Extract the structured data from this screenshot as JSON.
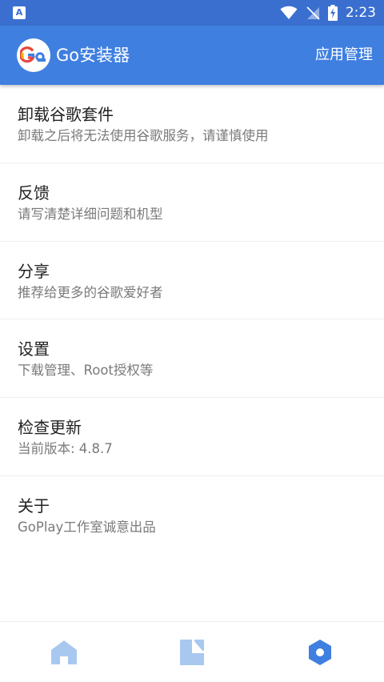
{
  "status_bar": {
    "notification_badge": "A",
    "time": "2:23",
    "icons": [
      "wifi-icon",
      "no-signal-icon",
      "battery-charging-icon"
    ]
  },
  "app_bar": {
    "logo_icon": "go-logo-icon",
    "title": "Go安装器",
    "action_label": "应用管理",
    "background_color": "#3f7fe0"
  },
  "menu": {
    "items": [
      {
        "title": "卸载谷歌套件",
        "subtitle": "卸载之后将无法使用谷歌服务，请谨慎使用"
      },
      {
        "title": "反馈",
        "subtitle": "请写清楚详细问题和机型"
      },
      {
        "title": "分享",
        "subtitle": "推荐给更多的谷歌爱好者"
      },
      {
        "title": "设置",
        "subtitle": "下载管理、Root授权等"
      },
      {
        "title": "检查更新",
        "subtitle": "当前版本: 4.8.7"
      },
      {
        "title": "关于",
        "subtitle": "GoPlay工作室诚意出品"
      }
    ]
  },
  "bottom_nav": {
    "items": [
      {
        "icon": "home-icon",
        "active": false
      },
      {
        "icon": "apps-icon",
        "active": false
      },
      {
        "icon": "settings-hexagon-icon",
        "active": true
      }
    ],
    "inactive_color": "#a9c8f0",
    "active_color": "#3f7fe0"
  }
}
